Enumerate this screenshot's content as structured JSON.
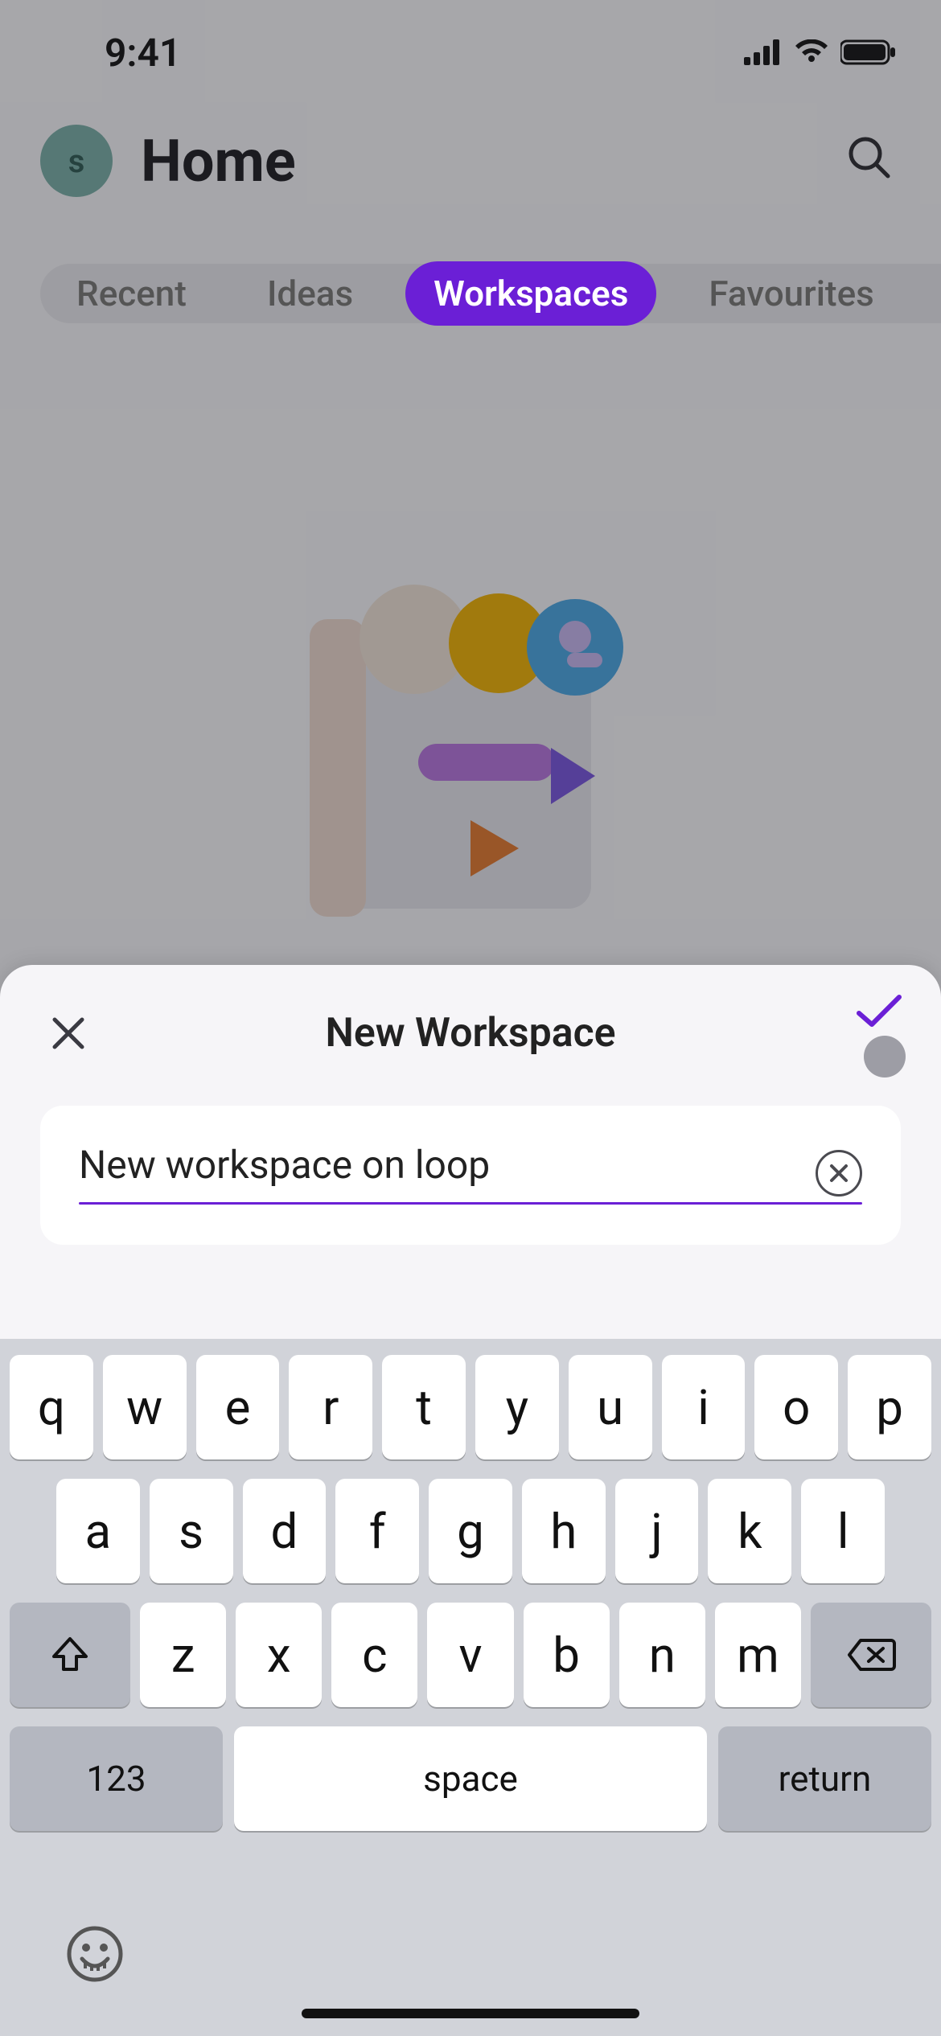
{
  "status": {
    "time": "9:41"
  },
  "header": {
    "avatar_initial": "s",
    "title": "Home"
  },
  "tabs": {
    "items": [
      {
        "label": "Recent",
        "active": false
      },
      {
        "label": "Ideas",
        "active": false
      },
      {
        "label": "Workspaces",
        "active": true
      },
      {
        "label": "Favourites",
        "active": false
      }
    ]
  },
  "sheet": {
    "title": "New Workspace",
    "input_value": "New workspace on loop",
    "accent": "#6b1fd6"
  },
  "keyboard": {
    "row1": [
      "q",
      "w",
      "e",
      "r",
      "t",
      "y",
      "u",
      "i",
      "o",
      "p"
    ],
    "row2": [
      "a",
      "s",
      "d",
      "f",
      "g",
      "h",
      "j",
      "k",
      "l"
    ],
    "row3": [
      "z",
      "x",
      "c",
      "v",
      "b",
      "n",
      "m"
    ],
    "numeric_label": "123",
    "space_label": "space",
    "return_label": "return"
  }
}
